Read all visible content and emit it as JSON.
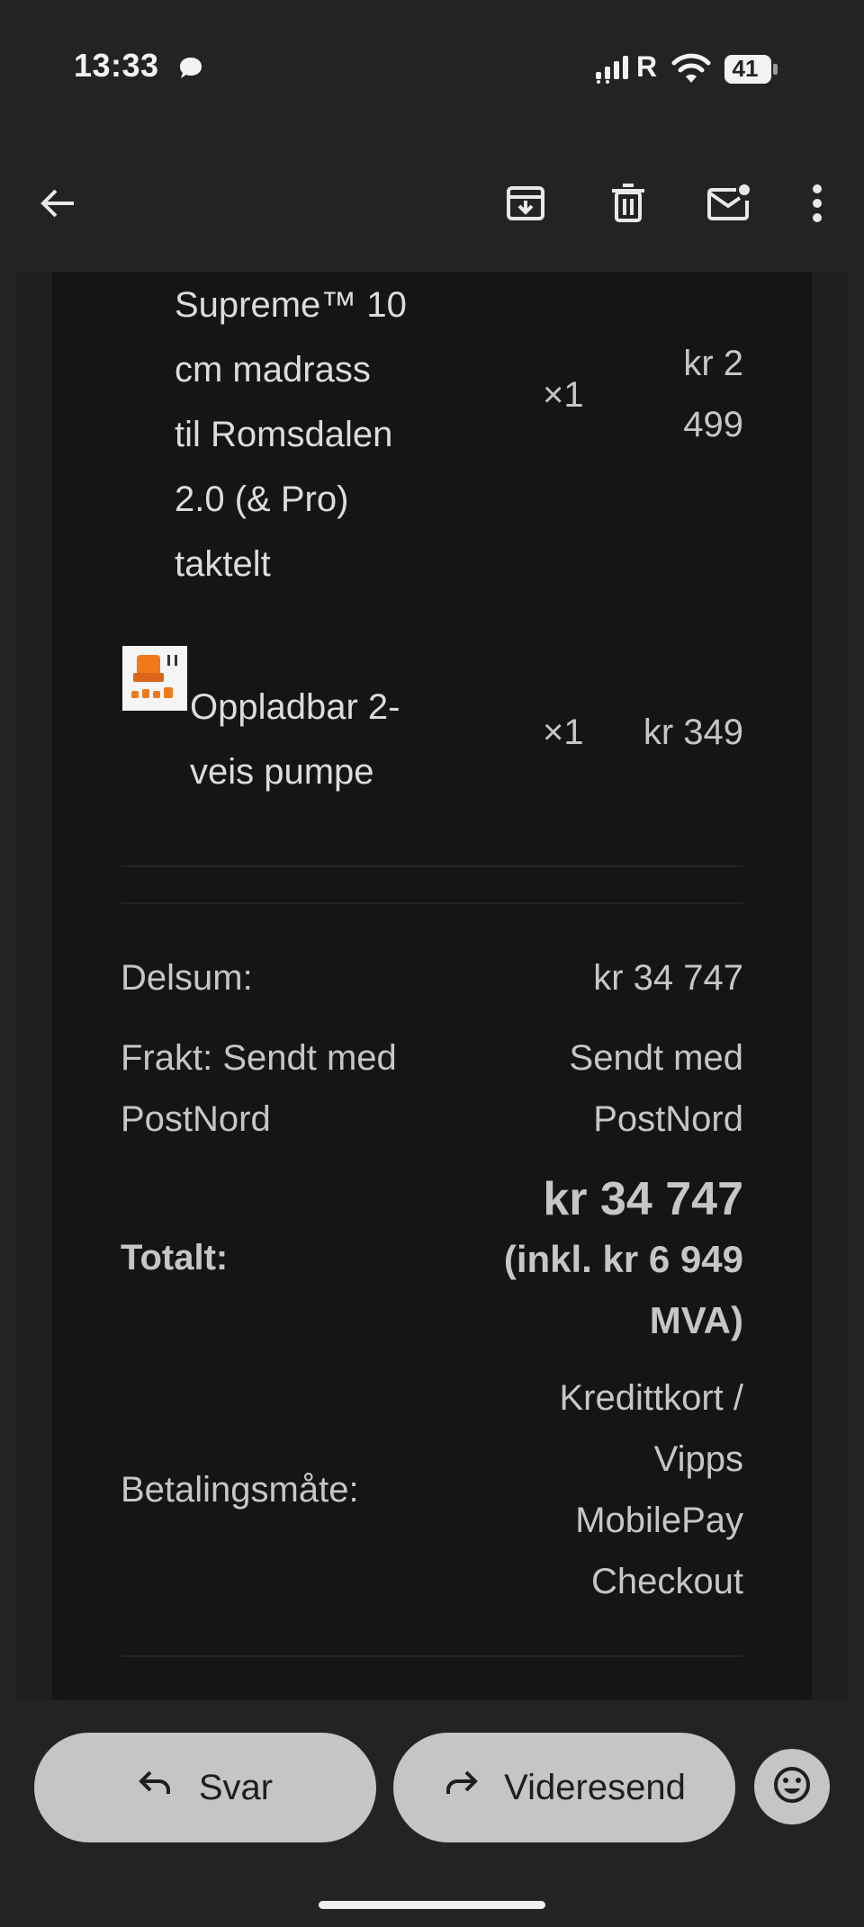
{
  "status_bar": {
    "time": "13:33",
    "carrier_flag": "R",
    "battery": "41",
    "icons": [
      "chat-bubble-icon",
      "signal-icon",
      "wifi-icon",
      "battery-icon"
    ]
  },
  "app_bar": {
    "icons": [
      "back-arrow-icon",
      "archive-icon",
      "delete-icon",
      "mark-unread-icon",
      "more-vert-icon"
    ]
  },
  "order": {
    "items": [
      {
        "name_lines": [
          "Supreme™ 10",
          "cm madrass",
          "til Romsdalen",
          "2.0 (& Pro)",
          "taktelt"
        ],
        "qty": "×1",
        "price_lines": [
          "kr 2",
          "499"
        ]
      },
      {
        "name_lines": [
          "Oppladbar 2-",
          "veis pumpe"
        ],
        "qty": "×1",
        "price": "kr 349",
        "thumbnail": "pump-product-image"
      }
    ],
    "subtotal": {
      "label": "Delsum:",
      "value": "kr 34 747"
    },
    "shipping": {
      "label_lines": [
        "Frakt: Sendt med",
        "PostNord"
      ],
      "value_lines": [
        "Sendt med",
        "PostNord"
      ]
    },
    "total": {
      "label": "Totalt:",
      "value_lines": [
        "kr 34 747",
        "(inkl. kr 6 949",
        "MVA)"
      ]
    },
    "payment": {
      "label": "Betalingsmåte:",
      "value_lines": [
        "Kredittkort /",
        "Vipps",
        "MobilePay",
        "Checkout"
      ]
    }
  },
  "actions": {
    "reply": "Svar",
    "forward": "Videresend",
    "icons": [
      "reply-icon",
      "forward-icon",
      "emoji-reaction-icon"
    ]
  },
  "colors": {
    "background": "#232323",
    "card": "#151515",
    "pill": "#c5c5c5"
  }
}
